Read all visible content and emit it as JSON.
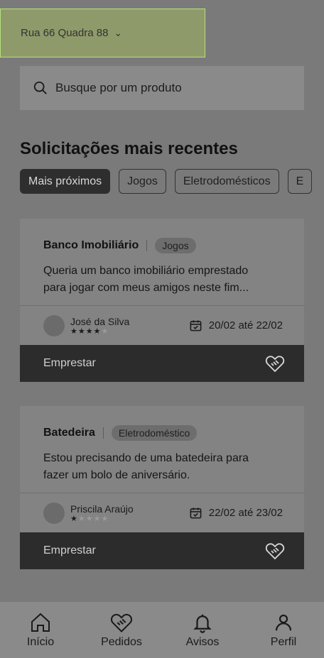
{
  "header": {
    "address": "Rua 66 Quadra 88"
  },
  "search": {
    "placeholder": "Busque por um produto"
  },
  "section": {
    "title": "Solicitações mais recentes"
  },
  "filters": [
    {
      "label": "Mais próximos",
      "active": true
    },
    {
      "label": "Jogos",
      "active": false
    },
    {
      "label": "Eletrodomésticos",
      "active": false
    },
    {
      "label": "E",
      "active": false
    }
  ],
  "requests": [
    {
      "title": "Banco Imobiliário",
      "tag": "Jogos",
      "description_line1": "Queria um banco imobiliário emprestado",
      "description_line2": "para jogar com meus amigos neste fim...",
      "user": "José da Silva",
      "rating": 4,
      "dates": "20/02 até 22/02",
      "action": "Emprestar"
    },
    {
      "title": "Batedeira",
      "tag": "Eletrodoméstico",
      "description_line1": "Estou precisando de uma batedeira para",
      "description_line2": "fazer um bolo de aniversário.",
      "user": "Priscila Araújo",
      "rating": 1,
      "dates": "22/02 até 23/02",
      "action": "Emprestar"
    }
  ],
  "nav": {
    "home": "Início",
    "orders": "Pedidos",
    "notices": "Avisos",
    "profile": "Perfil"
  }
}
